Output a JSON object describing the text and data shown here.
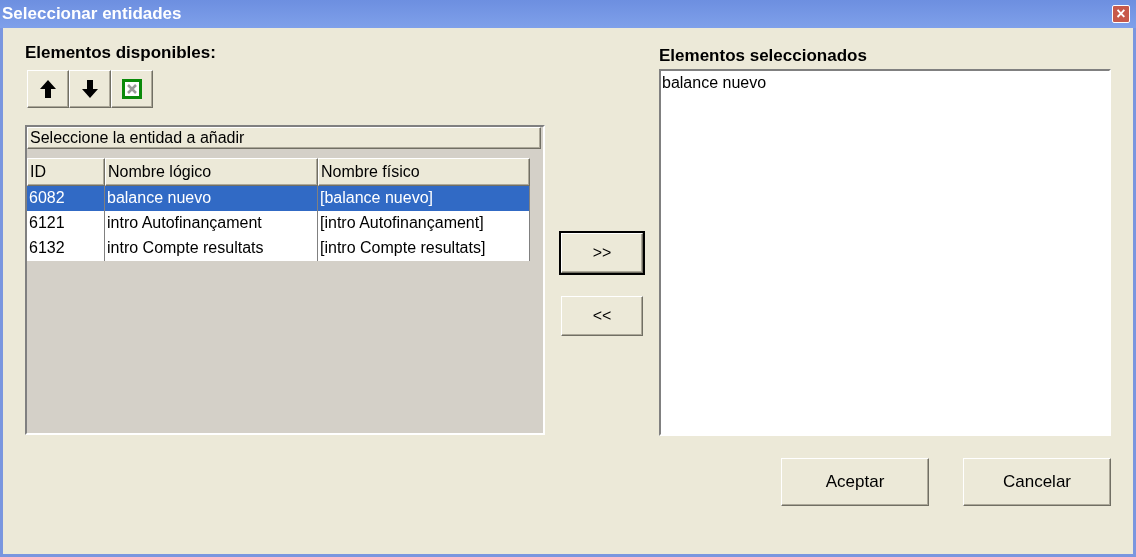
{
  "window": {
    "title": "Seleccionar entidades",
    "close": "×"
  },
  "available": {
    "label": "Elementos disponibles:",
    "caption": "Seleccione la entidad a añadir",
    "columns": [
      "ID",
      "Nombre lógico",
      "Nombre físico"
    ],
    "rows": [
      {
        "cells": [
          "6082",
          "balance nuevo",
          "[balance nuevo]"
        ],
        "selected": true
      },
      {
        "cells": [
          "6121",
          "intro Autofinançament",
          "[intro Autofinançament]"
        ],
        "selected": false
      },
      {
        "cells": [
          "6132",
          "intro Compte resultats",
          "[intro Compte resultats]"
        ],
        "selected": false
      }
    ]
  },
  "toolbar": [
    {
      "kind": "up"
    },
    {
      "kind": "down"
    },
    {
      "kind": "excel"
    }
  ],
  "move_buttons": [
    {
      "label": ">>",
      "default": true
    },
    {
      "label": "<<",
      "default": false
    }
  ],
  "selected_list": {
    "label": "Elementos seleccionados",
    "items": [
      "balance nuevo"
    ]
  },
  "buttons": [
    "Aceptar",
    "Cancelar"
  ]
}
